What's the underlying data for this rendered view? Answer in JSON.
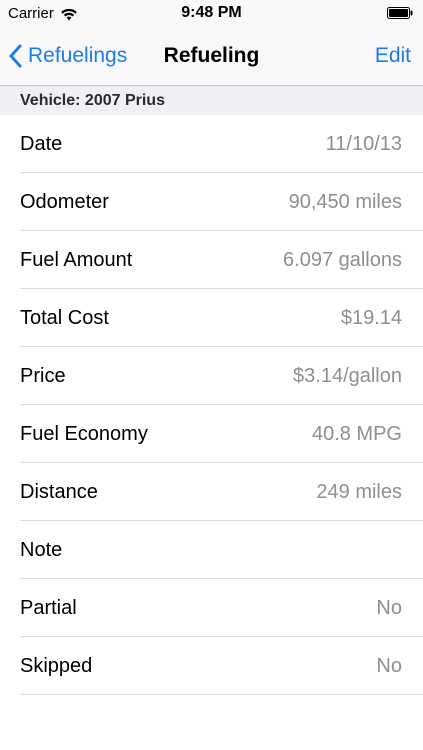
{
  "status_bar": {
    "carrier": "Carrier",
    "time": "9:48 PM"
  },
  "nav": {
    "back_label": "Refuelings",
    "title": "Refueling",
    "edit_label": "Edit"
  },
  "section": {
    "header": "Vehicle: 2007 Prius"
  },
  "rows": [
    {
      "label": "Date",
      "value": "11/10/13"
    },
    {
      "label": "Odometer",
      "value": "90,450 miles"
    },
    {
      "label": "Fuel Amount",
      "value": "6.097 gallons"
    },
    {
      "label": "Total Cost",
      "value": "$19.14"
    },
    {
      "label": "Price",
      "value": "$3.14/gallon"
    },
    {
      "label": "Fuel Economy",
      "value": "40.8 MPG"
    },
    {
      "label": "Distance",
      "value": "249 miles"
    },
    {
      "label": "Note",
      "value": ""
    },
    {
      "label": "Partial",
      "value": "No"
    },
    {
      "label": "Skipped",
      "value": "No"
    }
  ],
  "colors": {
    "accent": "#1d7ce8",
    "value_text": "#8e8e93",
    "section_bg": "#efeff4",
    "bar_bg": "#f8f8f8"
  },
  "icons": [
    "wifi-icon",
    "battery-icon",
    "chevron-left-icon"
  ]
}
